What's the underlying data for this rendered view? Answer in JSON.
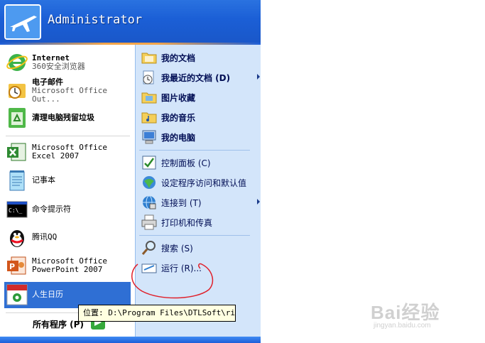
{
  "user": {
    "name": "Administrator"
  },
  "left_items": [
    {
      "title": "Internet",
      "subtitle": "360安全浏览器",
      "icon": "ie-icon"
    },
    {
      "title": "电子邮件",
      "subtitle": "Microsoft Office Out...",
      "icon": "outlook-icon"
    },
    {
      "title": "清理电脑残留垃圾",
      "subtitle": "",
      "icon": "recycle-icon"
    },
    {
      "title": "Microsoft Office Excel 2007",
      "subtitle": "",
      "icon": "excel-icon"
    },
    {
      "title": "记事本",
      "subtitle": "",
      "icon": "notepad-icon"
    },
    {
      "title": "命令提示符",
      "subtitle": "",
      "icon": "cmd-icon"
    },
    {
      "title": "腾讯QQ",
      "subtitle": "",
      "icon": "qq-icon"
    },
    {
      "title": "Microsoft Office PowerPoint 2007",
      "subtitle": "",
      "icon": "powerpoint-icon"
    },
    {
      "title": "人生日历",
      "subtitle": "",
      "icon": "calendar-icon",
      "selected": true
    }
  ],
  "all_programs": "所有程序 (P)",
  "right_items": [
    {
      "label": "我的文档",
      "bold": true,
      "icon": "folder-icon"
    },
    {
      "label": "我最近的文档 (D)",
      "bold": true,
      "icon": "recent-docs-icon",
      "submenu": true
    },
    {
      "label": "图片收藏",
      "bold": true,
      "icon": "pictures-folder-icon"
    },
    {
      "label": "我的音乐",
      "bold": true,
      "icon": "music-folder-icon"
    },
    {
      "label": "我的电脑",
      "bold": true,
      "icon": "computer-icon"
    },
    {
      "label": "控制面板 (C)",
      "bold": false,
      "icon": "control-panel-icon"
    },
    {
      "label": "设定程序访问和默认值",
      "bold": false,
      "icon": "defaults-icon"
    },
    {
      "label": "连接到 (T)",
      "bold": false,
      "icon": "network-icon",
      "submenu": true
    },
    {
      "label": "打印机和传真",
      "bold": false,
      "icon": "printer-icon"
    },
    {
      "label": "搜索 (S)",
      "bold": false,
      "icon": "search-icon"
    },
    {
      "label": "运行 (R)...",
      "bold": false,
      "icon": "run-icon"
    }
  ],
  "tooltip": "位置: D:\\Program Files\\DTLSoft\\rili",
  "watermark": {
    "brand": "Bai经验",
    "url": "jingyan.baidu.com"
  },
  "colors": {
    "header_blue": "#1b5fd6",
    "right_pane": "#d3e5fa",
    "selection": "#2f6fd4",
    "annotation": "#e0202a"
  }
}
